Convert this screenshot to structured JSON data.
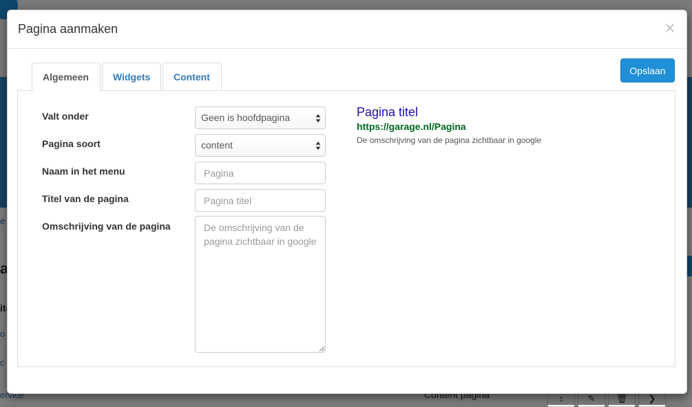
{
  "background": {
    "link_1": "e",
    "heading": "a",
    "subhead": "ite",
    "link_2": "o",
    "link_3": "c",
    "link_4": "ervice",
    "table_cell": "Content pagina",
    "row_buttons": [
      "↕",
      "✎",
      "🗑",
      "❯"
    ]
  },
  "modal": {
    "title": "Pagina aanmaken",
    "close_label": "×",
    "save_label": "Opslaan",
    "tabs": [
      {
        "label": "Algemeen",
        "active": true
      },
      {
        "label": "Widgets",
        "active": false
      },
      {
        "label": "Content",
        "active": false
      }
    ]
  },
  "form": {
    "parent": {
      "label": "Valt onder",
      "value": "Geen is hoofdpagina"
    },
    "type": {
      "label": "Pagina soort",
      "value": "content"
    },
    "menu_name": {
      "label": "Naam in het menu",
      "placeholder": "Pagina",
      "value": ""
    },
    "page_title": {
      "label": "Titel van de pagina",
      "placeholder": "Pagina titel",
      "value": ""
    },
    "description": {
      "label": "Omschrijving van de pagina",
      "placeholder": "De omschrijving van de pagina zichtbaar in google",
      "value": ""
    }
  },
  "preview": {
    "title": "Pagina titel",
    "url": "https://garage.nl/Pagina",
    "description": "De omschrijving van de pagina zichtbaar in google"
  },
  "colors": {
    "primary_button": "#1f8fd8",
    "tab_link": "#337ab7",
    "preview_title": "#1a0dab",
    "preview_url": "#006621"
  }
}
